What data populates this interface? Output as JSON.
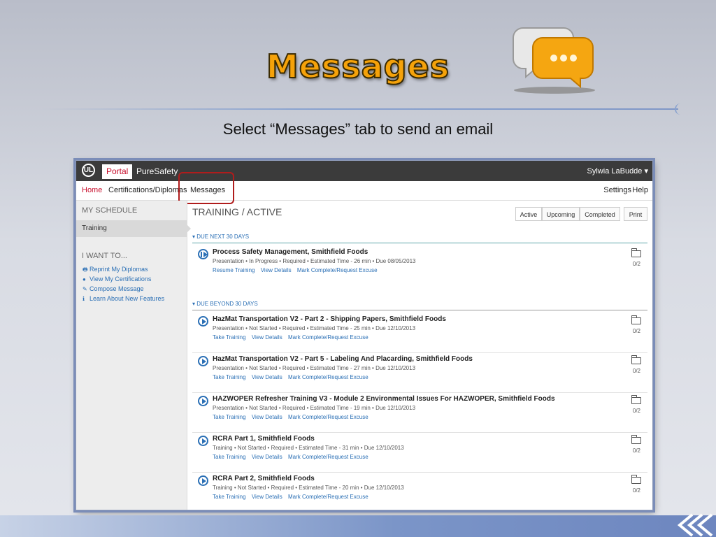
{
  "slide": {
    "title": "Messages",
    "subtitle": "Select “Messages” tab to send an email"
  },
  "app": {
    "logo": "UL",
    "portal_tab": "Portal",
    "brand": "PureSafety",
    "user": "Sylwia LaBudde ▾",
    "nav": {
      "home": "Home",
      "certifications": "Certifications/Diplomas",
      "messages": "Messages",
      "settings": "Settings",
      "help": "Help"
    },
    "sidebar": {
      "schedule_heading": "MY SCHEDULE",
      "training": "Training",
      "want_heading": "I WANT TO...",
      "links": [
        {
          "icon": "printer-icon",
          "label": "Reprint My Diplomas"
        },
        {
          "icon": "bullet-icon",
          "label": "View My Certifications"
        },
        {
          "icon": "pencil-icon",
          "label": "Compose Message"
        },
        {
          "icon": "info-icon",
          "label": "Learn About New Features"
        }
      ]
    },
    "main": {
      "title": "TRAINING / ACTIVE",
      "filters": {
        "active": "Active",
        "upcoming": "Upcoming",
        "completed": "Completed",
        "print": "Print"
      },
      "section_next": "▾ DUE NEXT 30 DAYS",
      "section_beyond": "▾ DUE BEYOND 30 DAYS",
      "courses": [
        {
          "title": "Process Safety Management, Smithfield Foods",
          "meta": "Presentation  •  In Progress  •  Required  •  Estimated Time - 26 min  •  Due 08/05/2013",
          "actions": [
            "Resume Training",
            "View Details",
            "Mark Complete/Request Excuse"
          ],
          "count": "0/2"
        },
        {
          "title": "HazMat Transportation V2 - Part 2 - Shipping Papers, Smithfield Foods",
          "meta": "Presentation  •  Not Started  •  Required  •  Estimated Time - 25 min  •  Due 12/10/2013",
          "actions": [
            "Take Training",
            "View Details",
            "Mark Complete/Request Excuse"
          ],
          "count": "0/2"
        },
        {
          "title": "HazMat Transportation V2 - Part 5 - Labeling And Placarding, Smithfield Foods",
          "meta": "Presentation  •  Not Started  •  Required  •  Estimated Time - 27 min  •  Due 12/10/2013",
          "actions": [
            "Take Training",
            "View Details",
            "Mark Complete/Request Excuse"
          ],
          "count": "0/2"
        },
        {
          "title": "HAZWOPER Refresher Training V3 - Module 2 Environmental Issues For HAZWOPER, Smithfield Foods",
          "meta": "Presentation  •  Not Started  •  Required  •  Estimated Time - 19 min  •  Due 12/10/2013",
          "actions": [
            "Take Training",
            "View Details",
            "Mark Complete/Request Excuse"
          ],
          "count": "0/2"
        },
        {
          "title": "RCRA Part 1, Smithfield Foods",
          "meta": "Training  •  Not Started  •  Required  •  Estimated Time - 31 min  •  Due 12/10/2013",
          "actions": [
            "Take Training",
            "View Details",
            "Mark Complete/Request Excuse"
          ],
          "count": "0/2"
        },
        {
          "title": "RCRA Part 2, Smithfield Foods",
          "meta": "Training  •  Not Started  •  Required  •  Estimated Time - 20 min  •  Due 12/10/2013",
          "actions": [
            "Take Training",
            "View Details",
            "Mark Complete/Request Excuse"
          ],
          "count": "0/2"
        }
      ]
    }
  },
  "colors": {
    "accent_red": "#c8102e",
    "link_blue": "#2a6fb5",
    "title_orange": "#f5a20a",
    "highlight_red": "#b01c1c"
  }
}
